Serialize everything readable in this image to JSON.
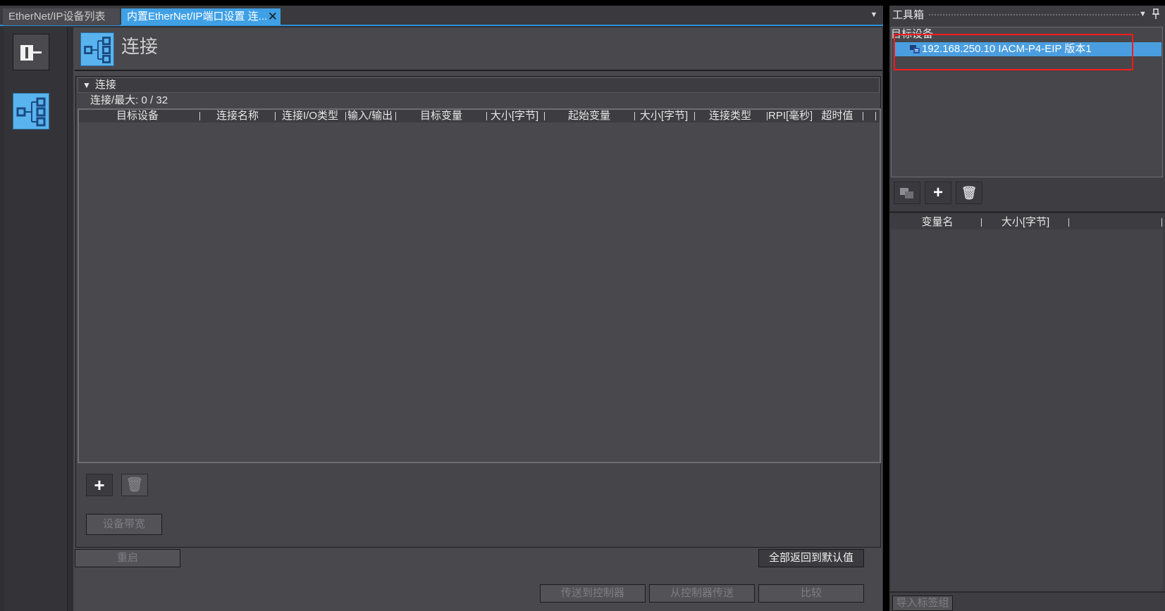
{
  "tabs": [
    {
      "label": "EtherNet/IP设备列表"
    },
    {
      "label": "内置EtherNet/IP端口设置 连...",
      "close": "✕"
    }
  ],
  "page": {
    "title": "连接"
  },
  "section": {
    "title": "连接",
    "count_label": "连接/最大: 0 / 32"
  },
  "grid": {
    "columns": [
      "目标设备",
      "连接名称",
      "连接I/O类型",
      "输入/输出",
      "目标变量",
      "大小[字节]",
      "起始变量",
      "大小[字节]",
      "连接类型",
      "RPI[毫秒]",
      "超时值"
    ],
    "rows": []
  },
  "buttons": {
    "add": "+",
    "delete": "🗑",
    "bandwidth": "设备带宽",
    "restart": "重启",
    "reset_all": "全部返回到默认值",
    "transfer_to": "传送到控制器",
    "transfer_from": "从控制器传送",
    "compare": "比较"
  },
  "toolbox": {
    "title": "工具箱",
    "pin": "📌",
    "target_label": "目标设备",
    "devices": [
      {
        "label": "192.168.250.10   IACM-P4-EIP   版本1",
        "selected": true
      }
    ],
    "var_columns": [
      "变量名",
      "大小[字节]"
    ],
    "import_label": "导入标签组"
  },
  "colors": {
    "accent": "#3fa0e6",
    "selection": "#4a9ee0",
    "highlight_box": "#ff1a1a",
    "background": "#48484d"
  }
}
